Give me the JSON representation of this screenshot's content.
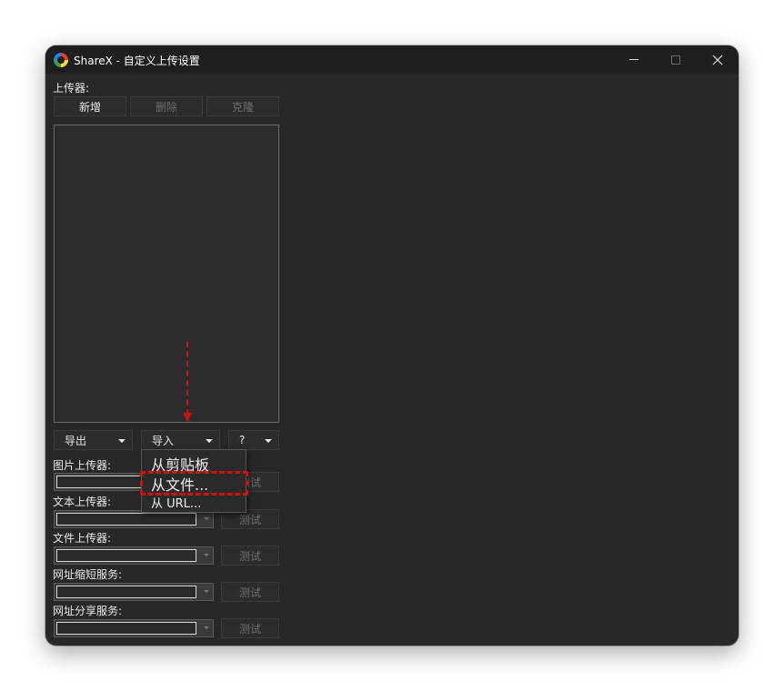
{
  "window": {
    "title": "ShareX - 自定义上传设置",
    "app_icon": "sharex-logo-icon"
  },
  "uploaders": {
    "label": "上传器:",
    "buttons": {
      "new": "新增",
      "delete": "删除",
      "clone": "克隆"
    }
  },
  "actions": {
    "export_label": "导出",
    "import_label": "导入",
    "help_label": "?"
  },
  "import_menu": {
    "items": [
      "从剪贴板",
      "从文件...",
      "从 URL..."
    ],
    "highlighted_index": 1
  },
  "destinations": [
    {
      "label": "图片上传器:",
      "selected": "",
      "test_label": "测试"
    },
    {
      "label": "文本上传器:",
      "selected": "",
      "test_label": "测试"
    },
    {
      "label": "文件上传器:",
      "selected": "",
      "test_label": "测试"
    },
    {
      "label": "网址缩短服务:",
      "selected": "",
      "test_label": "测试"
    },
    {
      "label": "网址分享服务:",
      "selected": "",
      "test_label": "测试"
    }
  ],
  "colors": {
    "window_bg": "#282828",
    "titlebar_bg": "#1f1f1f",
    "annotation_red": "#d01010"
  }
}
